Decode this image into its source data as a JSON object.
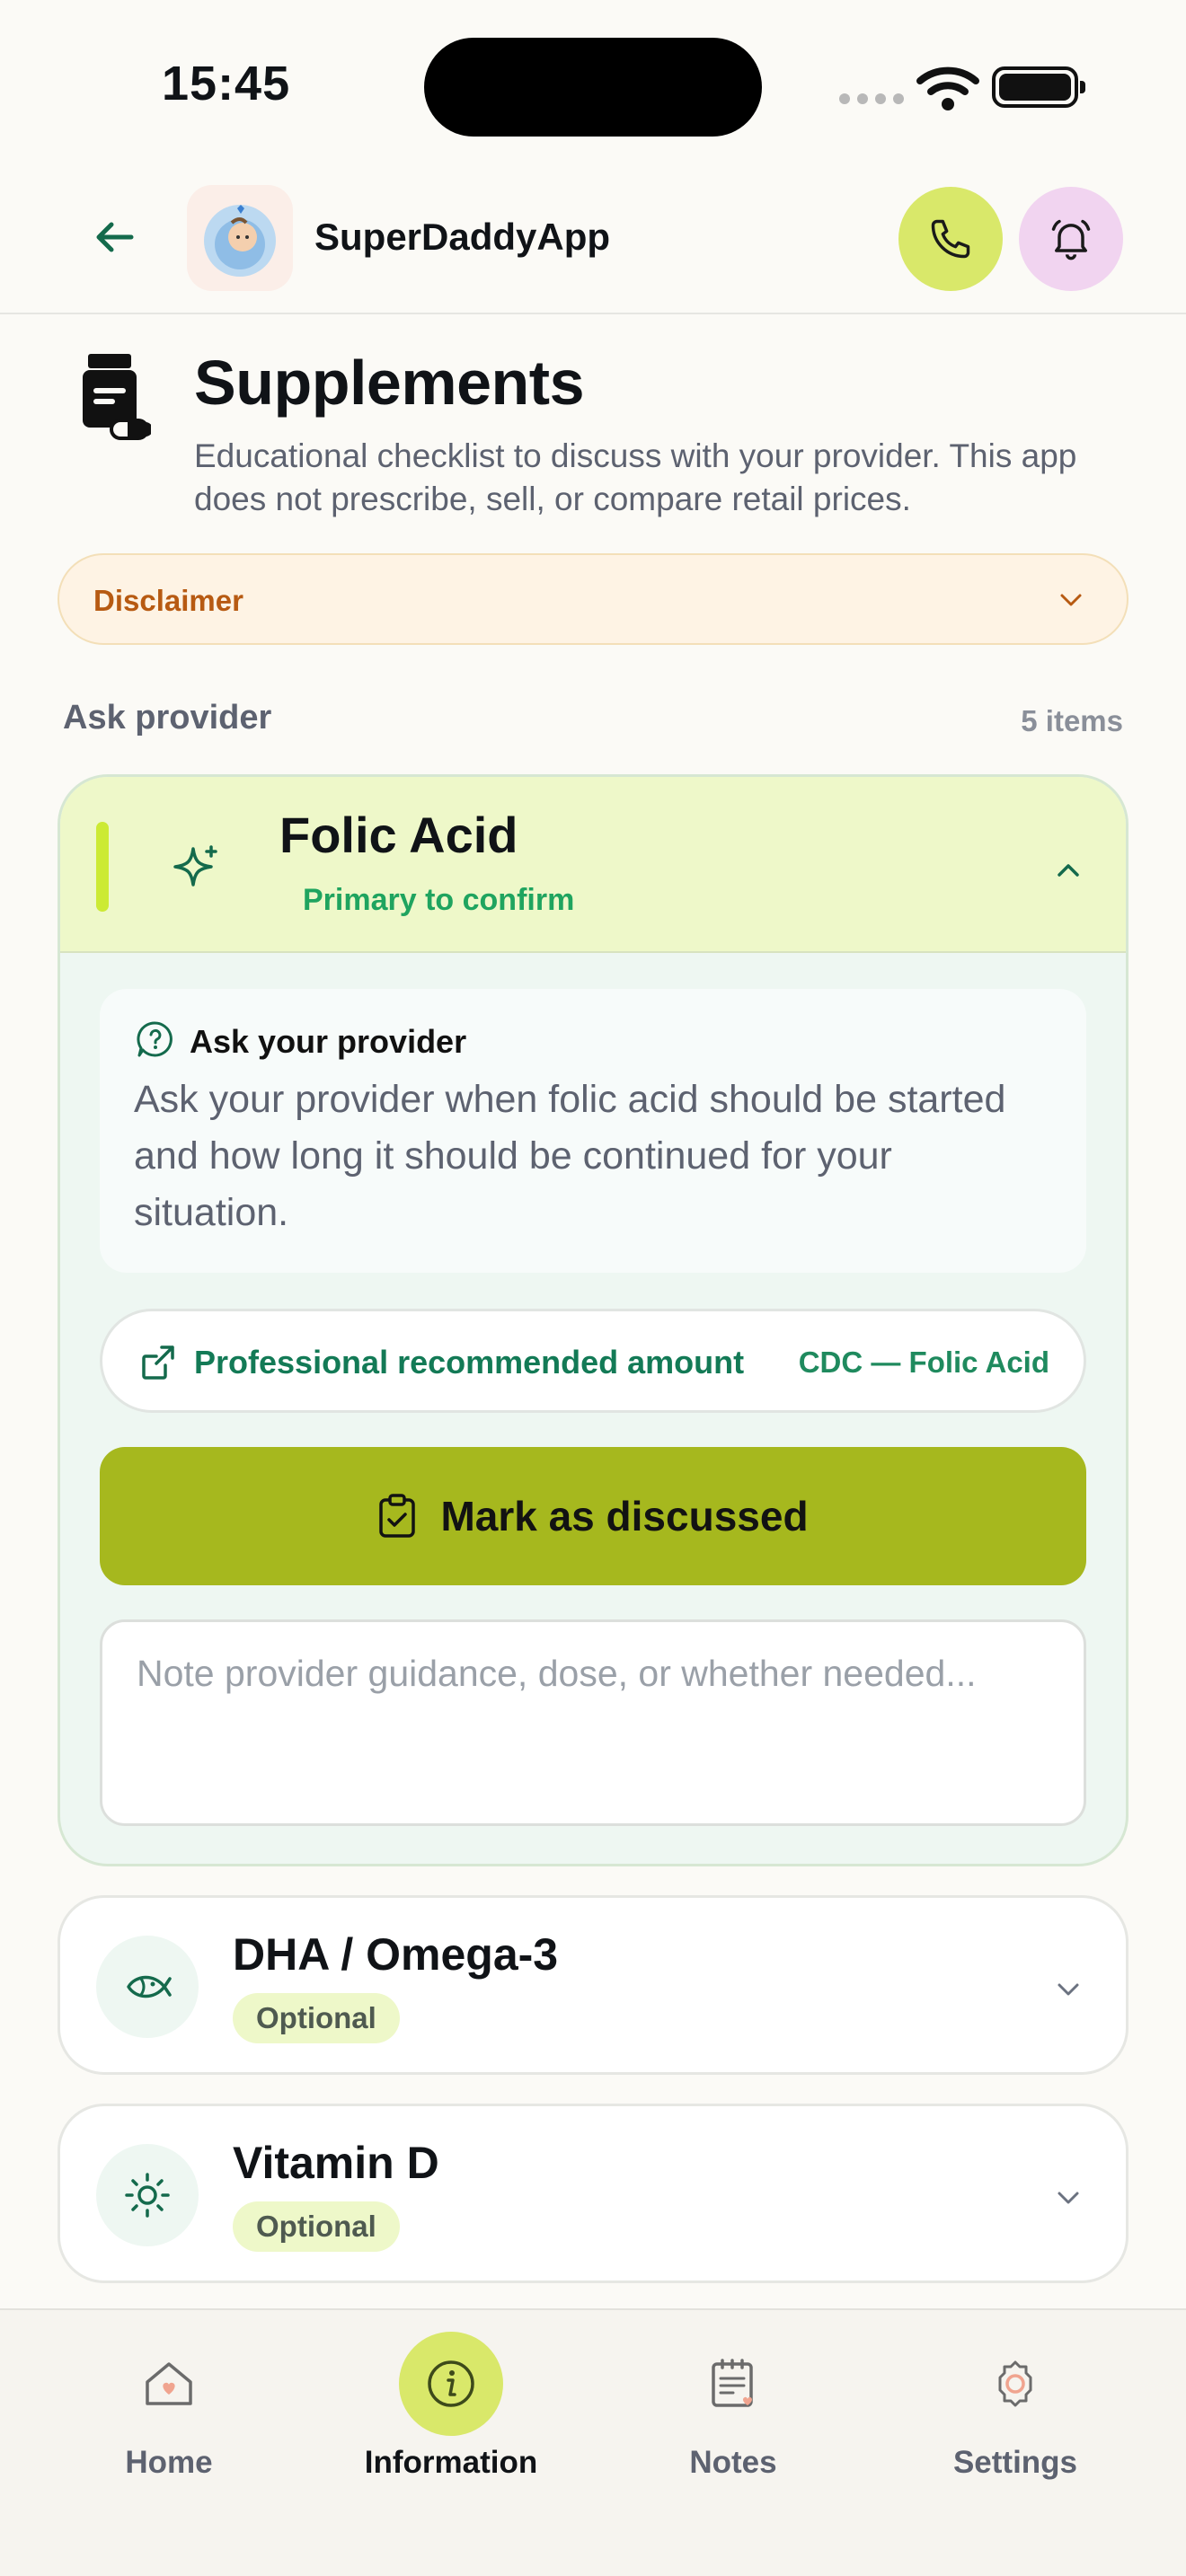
{
  "status_bar": {
    "time": "15:45"
  },
  "header": {
    "app_name": "SuperDaddyApp"
  },
  "page": {
    "title": "Supplements",
    "subtitle": "Educational checklist to discuss with your provider. This app does not prescribe, sell, or compare retail prices."
  },
  "disclaimer": {
    "label": "Disclaimer"
  },
  "section": {
    "label": "Ask provider",
    "count": "5 items"
  },
  "items": [
    {
      "title": "Folic Acid",
      "status": "Primary to confirm",
      "expanded": true,
      "icon": "sparkle-icon",
      "ask_title": "Ask your provider",
      "ask_text": "Ask your provider when folic acid should be started and how long it should be continued for your situation.",
      "link_label": "Professional recommended amount",
      "link_source": "CDC — Folic Acid",
      "mark_label": "Mark as discussed",
      "note_placeholder": "Note provider guidance, dose, or whether needed..."
    },
    {
      "title": "DHA / Omega-3",
      "badge": "Optional",
      "icon": "fish-icon"
    },
    {
      "title": "Vitamin D",
      "badge": "Optional",
      "icon": "sun-icon"
    }
  ],
  "tabs": [
    {
      "label": "Home",
      "icon": "home-icon"
    },
    {
      "label": "Information",
      "icon": "info-icon",
      "active": true
    },
    {
      "label": "Notes",
      "icon": "notes-icon"
    },
    {
      "label": "Settings",
      "icon": "settings-icon"
    }
  ],
  "colors": {
    "accent_lime": "#d9e86a",
    "button_olive": "#a6b81e",
    "green_text": "#1fa45f",
    "disclaimer_orange": "#b75a12"
  }
}
